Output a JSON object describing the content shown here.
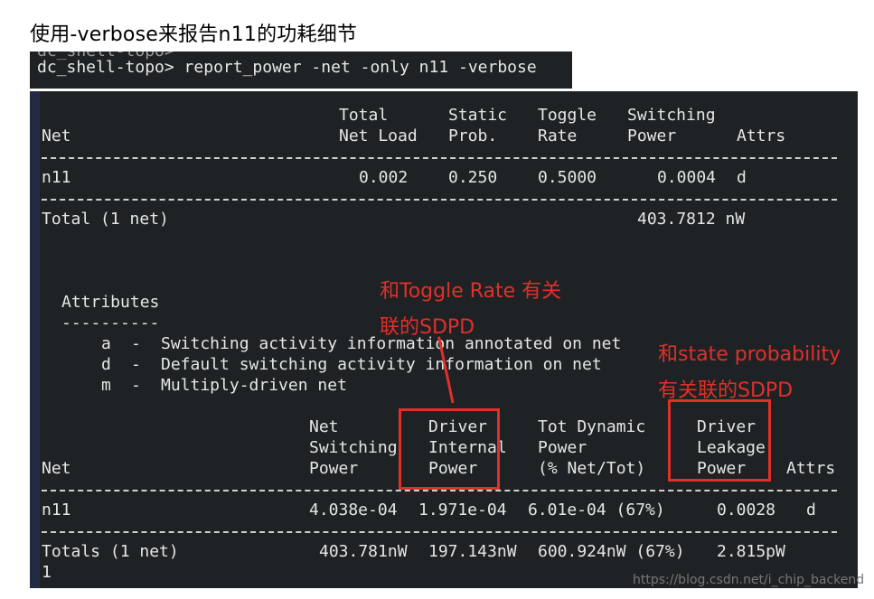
{
  "heading": "使用-verbose来报告n11的功耗细节",
  "command_window": {
    "ghost_line": "dc_shell-topo>",
    "command": "dc_shell-topo> report_power -net -only n11 -verbose"
  },
  "table1": {
    "headers": {
      "net": "Net",
      "total_net_load_1": "Total",
      "total_net_load_2": "Net Load",
      "static_prob_1": "Static",
      "static_prob_2": "Prob.",
      "toggle_rate_1": "Toggle",
      "toggle_rate_2": "Rate",
      "switching_power_1": "Switching",
      "switching_power_2": "Power",
      "attrs": "Attrs"
    },
    "row": {
      "net": "n11",
      "total_net_load": "0.002",
      "static_prob": "0.250",
      "toggle_rate": "0.5000",
      "switching_power": "0.0004",
      "attrs": "d"
    },
    "total": {
      "label": "Total (1 net)",
      "value": "403.7812 nW"
    }
  },
  "attributes": {
    "title": "Attributes",
    "underline": "----------",
    "items": [
      {
        "key": "a",
        "sep": "-",
        "desc": "Switching activity information annotated on net"
      },
      {
        "key": "d",
        "sep": "-",
        "desc": "Default switching activity information on net"
      },
      {
        "key": "m",
        "sep": "-",
        "desc": "Multiply-driven net"
      }
    ]
  },
  "table2": {
    "headers": {
      "net": "Net",
      "net_switching_1": "Net",
      "net_switching_2": "Switching",
      "net_switching_3": "Power",
      "driver_internal_1": "Driver",
      "driver_internal_2": "Internal",
      "driver_internal_3": "Power",
      "tot_dynamic_1": "Tot Dynamic",
      "tot_dynamic_2": "Power",
      "tot_dynamic_3": "(% Net/Tot)",
      "driver_leakage_1": "Driver",
      "driver_leakage_2": "Leakage",
      "driver_leakage_3": "Power",
      "attrs": "Attrs"
    },
    "row": {
      "net": "n11",
      "net_switching": "4.038e-04",
      "driver_internal": "1.971e-04",
      "tot_dynamic": "6.01e-04 (67%)",
      "driver_leakage": "0.0028",
      "attrs": "d"
    },
    "totals": {
      "label": "Totals (1 net)",
      "net_switching": "403.781nW",
      "driver_internal": "197.143nW",
      "tot_dynamic": "600.924nW (67%)",
      "driver_leakage": "2.815pW"
    },
    "trailing": "1"
  },
  "annotations": {
    "toggle_line1": "和Toggle Rate 有关",
    "toggle_line2": "联的SDPD",
    "state_line1": "和state probability",
    "state_line2": "有关联的SDPD"
  },
  "watermark": "https://blog.csdn.net/i_chip_backend",
  "colors": {
    "terminal_bg": "#1f2224",
    "terminal_text": "#e6e6e6",
    "annotation_red": "#e0302a"
  }
}
